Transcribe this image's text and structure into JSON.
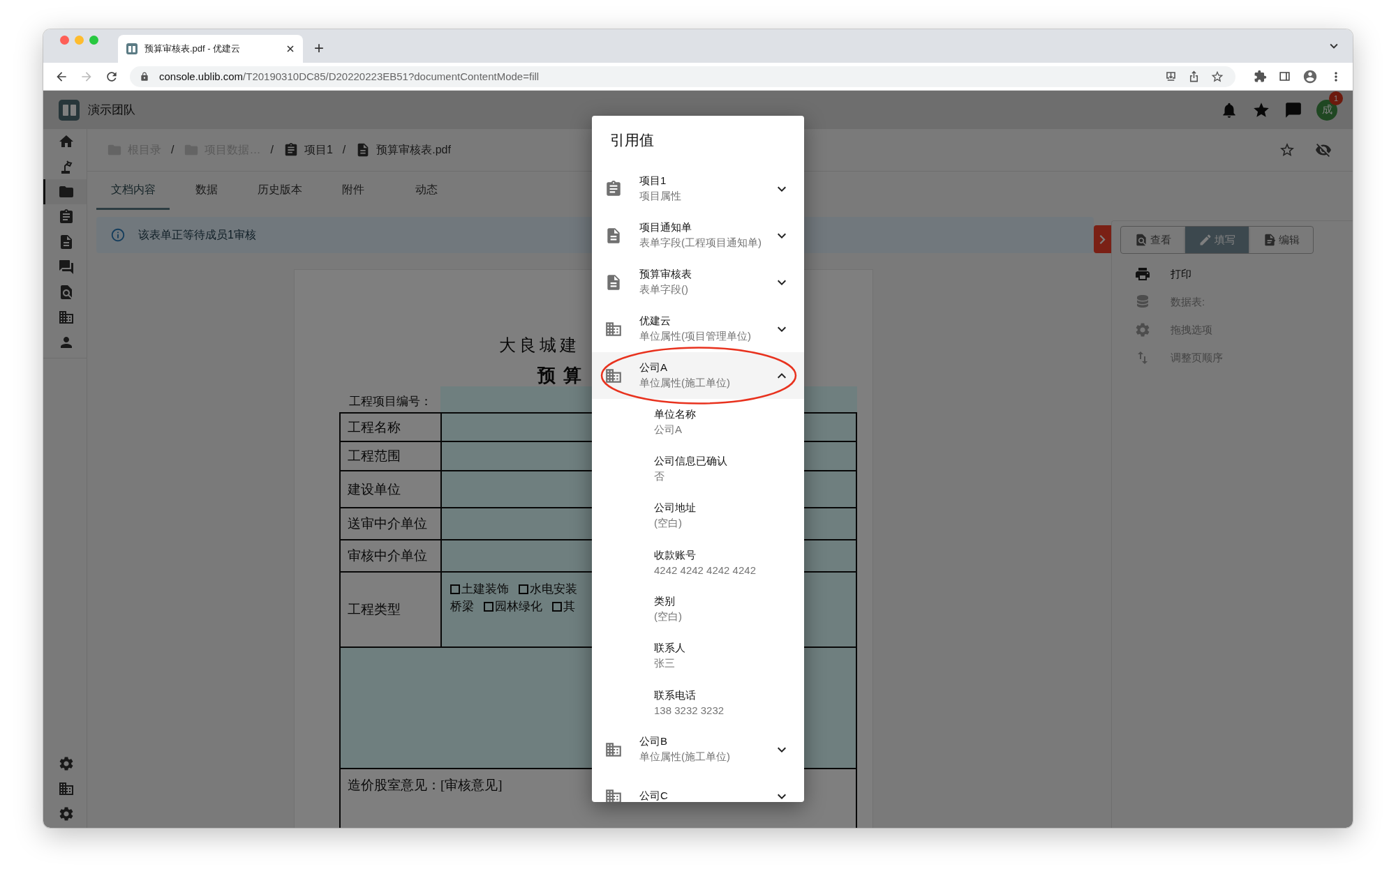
{
  "browser": {
    "tab_title": "预算审核表.pdf - 优建云",
    "new_tab": "+",
    "url_domain": "console.ublib.com",
    "url_path": "/T20190310DC85/D20220223EB51?documentContentMode=fill"
  },
  "header": {
    "team": "演示团队",
    "avatar": "成",
    "badge": "1"
  },
  "sidebar": {
    "items": [
      {
        "selected": false
      },
      {
        "selected": false
      },
      {
        "selected": true
      },
      {
        "selected": false
      },
      {
        "selected": false
      },
      {
        "selected": false
      },
      {
        "selected": false
      },
      {
        "selected": false
      },
      {
        "selected": false
      }
    ]
  },
  "breadcrumb": {
    "separator": "/",
    "items": [
      {
        "kind": "folder",
        "label": "根目录",
        "disabled": true
      },
      {
        "kind": "folder",
        "label": "项目数据…",
        "disabled": true
      },
      {
        "kind": "project",
        "label": "项目1",
        "disabled": false
      },
      {
        "kind": "file",
        "label": "预算审核表.pdf",
        "disabled": false
      }
    ]
  },
  "tabs": [
    {
      "label": "文档内容",
      "selected": true
    },
    {
      "label": "数据",
      "selected": false
    },
    {
      "label": "历史版本",
      "selected": false
    },
    {
      "label": "附件",
      "selected": false
    },
    {
      "label": "动态",
      "selected": false
    }
  ],
  "banner": {
    "text": "该表单正等待成员1审核"
  },
  "document": {
    "title": "大良城建",
    "subtitle": "预算",
    "number_label": "工程项目编号：",
    "rows": [
      {
        "label": "工程名称"
      },
      {
        "label": "工程范围"
      },
      {
        "label": "建设单位"
      },
      {
        "label": "送审中介单位"
      },
      {
        "label": "审核中介单位"
      },
      {
        "label": "工程类型",
        "options": [
          [
            {
              "kind": "checkbox",
              "label": "土建装饰",
              "checked": false
            },
            {
              "kind": "checkbox",
              "label": "水电安装",
              "checked": false
            }
          ],
          [
            {
              "kind": "text",
              "label": "桥梁"
            },
            {
              "kind": "checkbox",
              "label": "园林绿化",
              "checked": false
            },
            {
              "kind": "checkbox",
              "label": "其",
              "checked": false
            }
          ]
        ]
      }
    ],
    "opinion": "造价股室意见：[审核意见]"
  },
  "panel": {
    "modes": [
      {
        "label": "查看",
        "selected": false
      },
      {
        "label": "填写",
        "selected": true
      },
      {
        "label": "编辑",
        "selected": false
      }
    ],
    "actions": [
      {
        "label": "打印",
        "disabled": false
      },
      {
        "label": "数据表:",
        "disabled": true
      },
      {
        "label": "拖拽选项",
        "disabled": true
      },
      {
        "label": "调整页顺序",
        "disabled": true
      }
    ]
  },
  "dialog": {
    "title": "引用值",
    "items": [
      {
        "kind": "project",
        "title": "项目1",
        "subtitle": "项目属性",
        "expanded": false,
        "selected": false
      },
      {
        "kind": "form",
        "title": "项目通知单",
        "subtitle": "表单字段(工程项目通知单)",
        "expanded": false,
        "selected": false
      },
      {
        "kind": "form",
        "title": "预算审核表",
        "subtitle": "表单字段()",
        "expanded": false,
        "selected": false
      },
      {
        "kind": "unit",
        "title": "优建云",
        "subtitle": "单位属性(项目管理单位)",
        "expanded": false,
        "selected": false
      },
      {
        "kind": "unit",
        "title": "公司A",
        "subtitle": "单位属性(施工单位)",
        "expanded": true,
        "selected": true,
        "children": [
          {
            "name": "单位名称",
            "value": "公司A"
          },
          {
            "name": "公司信息已确认",
            "value": "否"
          },
          {
            "name": "公司地址",
            "value": "(空白)"
          },
          {
            "name": "收款账号",
            "value": "4242 4242 4242 4242"
          },
          {
            "name": "类别",
            "value": "(空白)"
          },
          {
            "name": "联系人",
            "value": "张三"
          },
          {
            "name": "联系电话",
            "value": "138 3232 3232"
          }
        ]
      },
      {
        "kind": "unit",
        "title": "公司B",
        "subtitle": "单位属性(施工单位)",
        "expanded": false,
        "selected": false
      },
      {
        "kind": "unit",
        "title": "公司C",
        "expanded": false,
        "selected": false
      }
    ]
  }
}
